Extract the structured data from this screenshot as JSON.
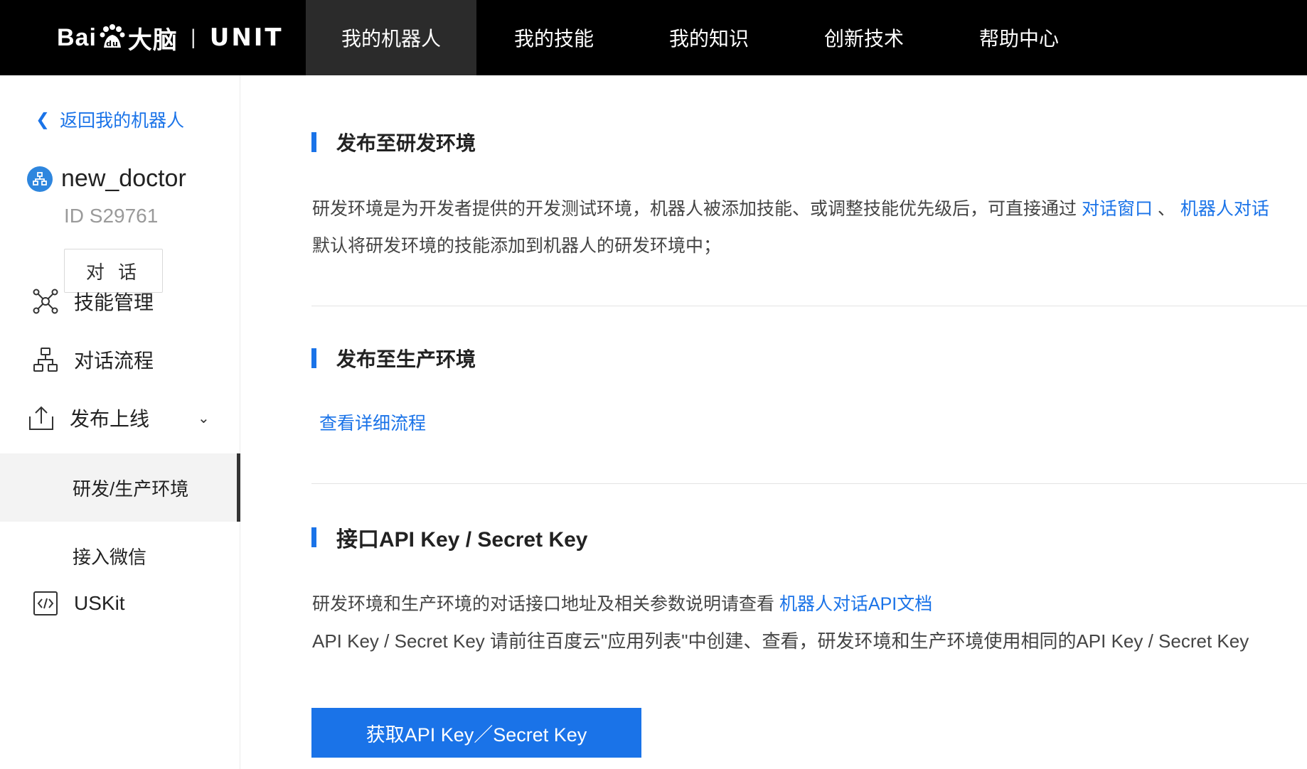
{
  "header": {
    "logo_text": "Bai大脑",
    "logo_sep": "|",
    "logo_product": "UNIT",
    "nav": [
      {
        "label": "我的机器人",
        "active": true
      },
      {
        "label": "我的技能"
      },
      {
        "label": "我的知识"
      },
      {
        "label": "创新技术"
      },
      {
        "label": "帮助中心"
      }
    ]
  },
  "sidebar": {
    "back_label": "返回我的机器人",
    "bot_name": "new_doctor",
    "bot_id": "ID S29761",
    "dialog_button": "对 话",
    "menu": [
      {
        "label": "技能管理",
        "icon": "network-icon"
      },
      {
        "label": "对话流程",
        "icon": "flow-icon"
      },
      {
        "label": "发布上线",
        "icon": "upload-icon"
      }
    ],
    "submenu": [
      {
        "label": "研发/生产环境",
        "active": true
      },
      {
        "label": "接入微信"
      }
    ],
    "uskit": {
      "label": "USKit",
      "icon": "code-icon"
    }
  },
  "main": {
    "dev": {
      "title": "发布至研发环境",
      "line1_text": "研发环境是为开发者提供的开发测试环境，机器人被添加技能、或调整技能优先级后，可直接通过 ",
      "line1_link1": "对话窗口",
      "line1_sep": " 、 ",
      "line1_link2": "机器人对话",
      "line2_text": "默认将研发环境的技能添加到机器人的研发环境中；"
    },
    "prod": {
      "title": "发布至生产环境",
      "link": "查看详细流程"
    },
    "api": {
      "title": "接口API Key / Secret Key",
      "line1_text": "研发环境和生产环境的对话接口地址及相关参数说明请查看 ",
      "line1_link": "机器人对话API文档",
      "line2_text": "API Key / Secret Key 请前往百度云\"应用列表\"中创建、查看，研发环境和生产环境使用相同的API Key / Secret Key",
      "button": "获取API Key／Secret Key"
    }
  },
  "colors": {
    "accent": "#1a73e8",
    "topbar": "#000000",
    "active_nav": "#2b2b2b"
  }
}
